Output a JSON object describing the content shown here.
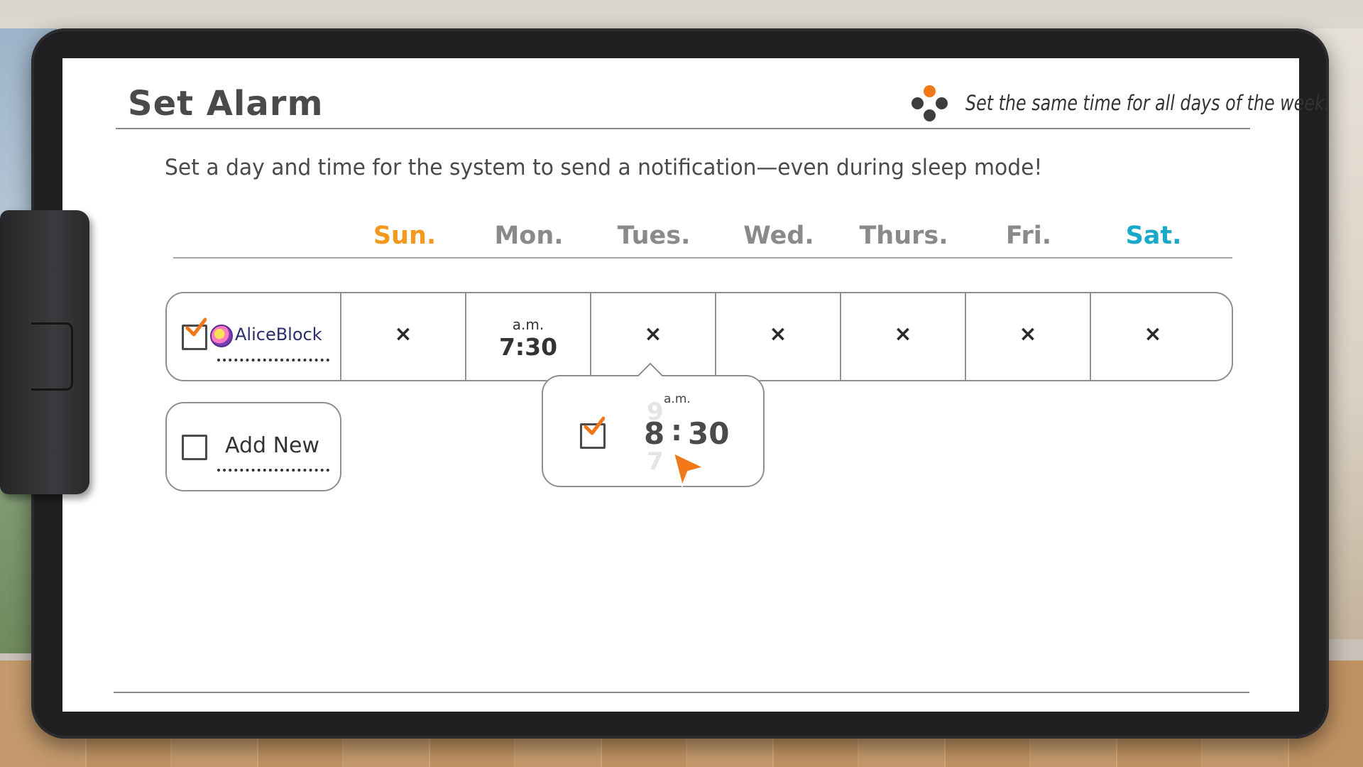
{
  "header": {
    "title": "Set Alarm",
    "hint_icon": "dpad-icon",
    "hint_text": "Set the same time for all days of the week."
  },
  "subtitle": "Set a day and time for the system to send a notification—even during sleep mode!",
  "days": [
    "Sun.",
    "Mon.",
    "Tues.",
    "Wed.",
    "Thurs.",
    "Fri.",
    "Sat."
  ],
  "colors": {
    "sunday": "#f39a1e",
    "saturday": "#1aa9c8",
    "accent_orange": "#f07818"
  },
  "alarm": {
    "user": "AliceBlock",
    "enabled": true,
    "cells": [
      "×",
      "a.m.|7:30",
      "×",
      "×",
      "×",
      "×",
      "×"
    ],
    "monday_ampm": "a.m.",
    "monday_time": "7:30",
    "off_mark": "×"
  },
  "add_new": {
    "label": "Add New"
  },
  "popup": {
    "enabled": true,
    "ampm": "a.m.",
    "hour": "8",
    "separator": ":",
    "minute": "30",
    "hour_prev": "9",
    "hour_next": "7"
  }
}
